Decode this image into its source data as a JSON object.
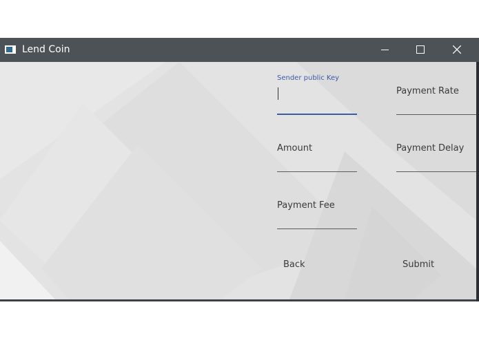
{
  "window": {
    "title": "Lend Coin",
    "controls": {
      "minimize": "minimize-icon",
      "maximize": "maximize-icon",
      "close": "close-icon"
    }
  },
  "form": {
    "sender_public_key": {
      "label": "Sender public Key",
      "value": ""
    },
    "payment_rate": {
      "label": "Payment Rate",
      "value": ""
    },
    "amount": {
      "label": "Amount",
      "value": ""
    },
    "payment_delay": {
      "label": "Payment Delay",
      "value": ""
    },
    "payment_fee": {
      "label": "Payment Fee",
      "value": ""
    }
  },
  "buttons": {
    "back": "Back",
    "submit": "Submit"
  },
  "colors": {
    "titlebar": "#4d5257",
    "content_bg": "#e2e2e2",
    "accent": "#3b5ba5"
  }
}
